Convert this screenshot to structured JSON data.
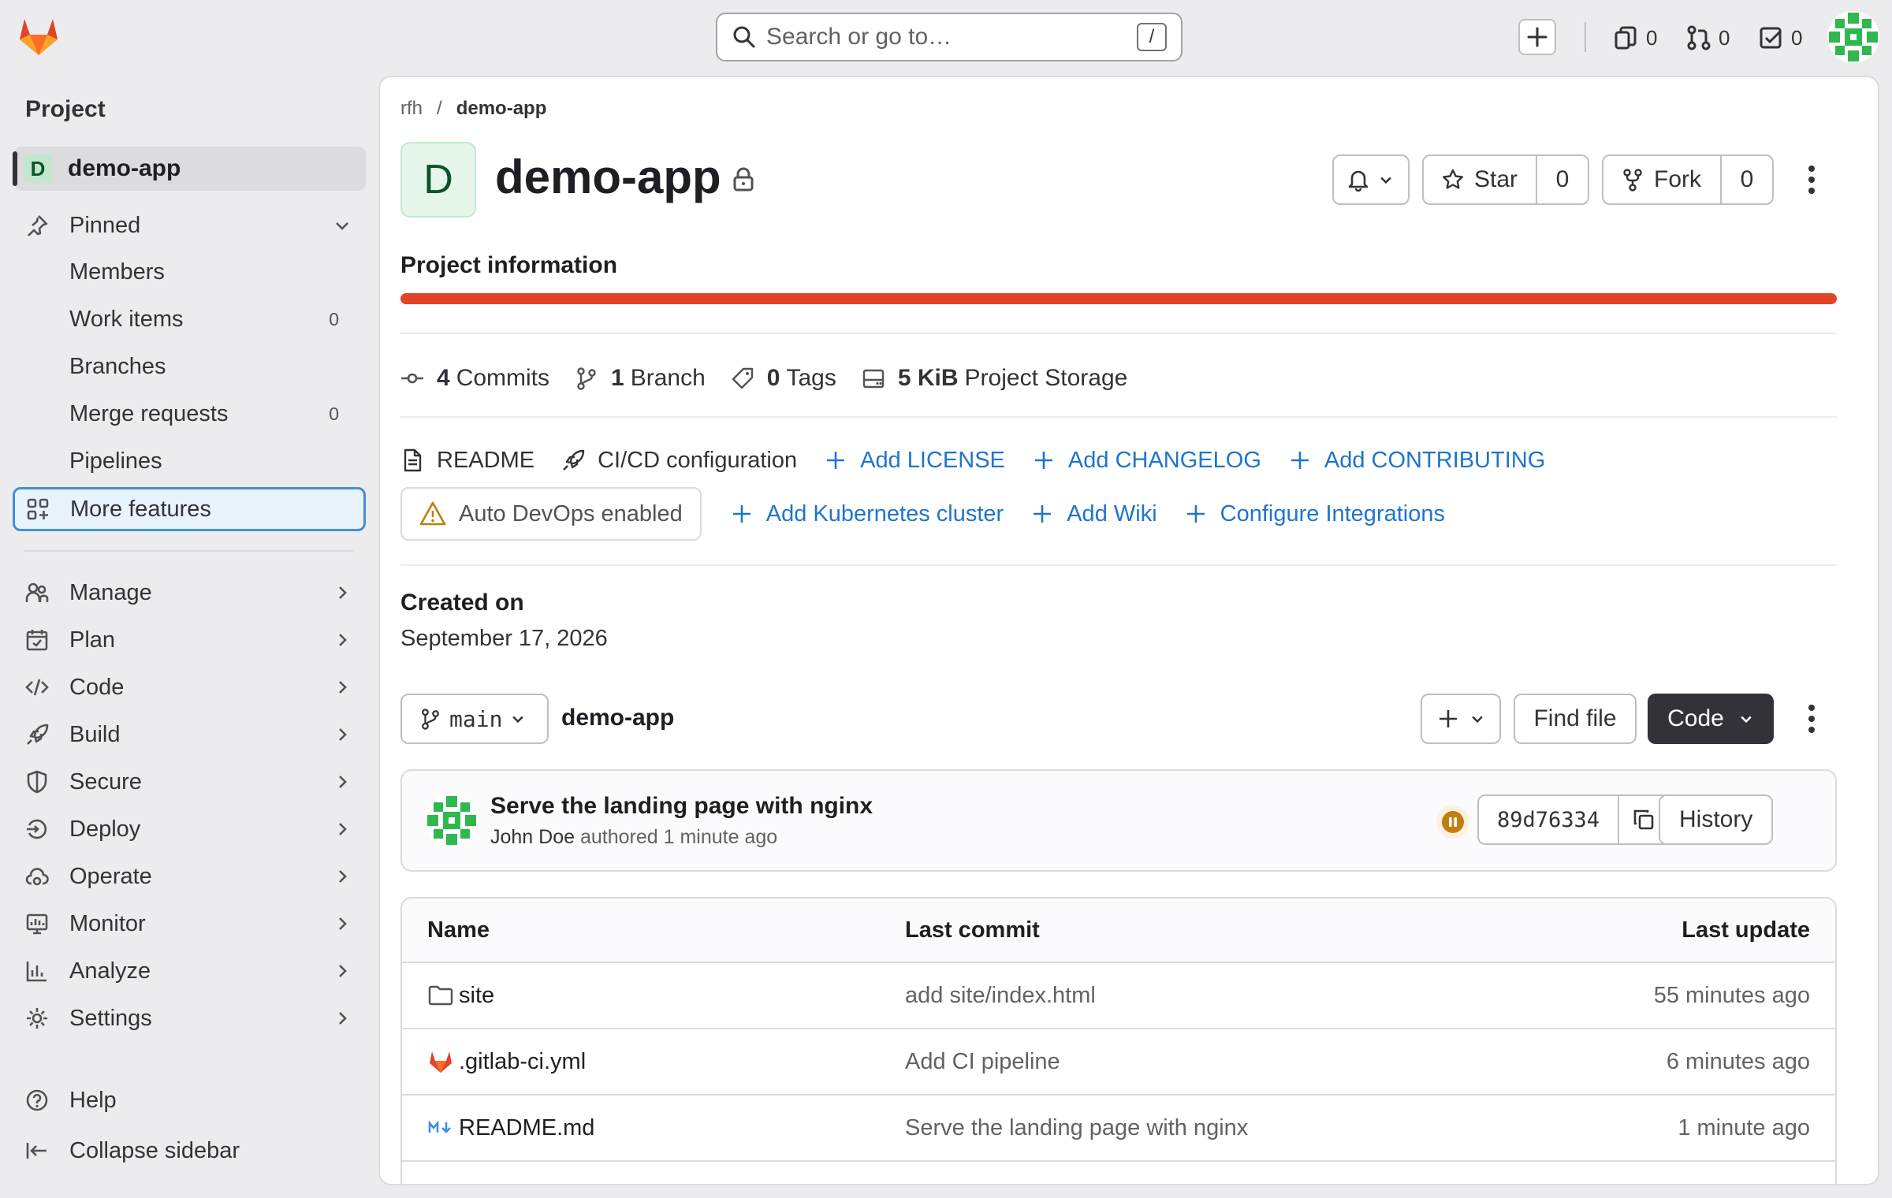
{
  "topbar": {
    "search_placeholder": "Search or go to…",
    "search_shortcut": "/",
    "issues_count": "0",
    "merge_requests_count": "0",
    "todos_count": "0"
  },
  "sidebar": {
    "heading": "Project",
    "project": {
      "initial": "D",
      "name": "demo-app"
    },
    "pinned_label": "Pinned",
    "pinned_items": [
      {
        "label": "Members",
        "count": ""
      },
      {
        "label": "Work items",
        "count": "0"
      },
      {
        "label": "Branches",
        "count": ""
      },
      {
        "label": "Merge requests",
        "count": "0"
      },
      {
        "label": "Pipelines",
        "count": ""
      }
    ],
    "more_features": "More features",
    "sections": [
      "Manage",
      "Plan",
      "Code",
      "Build",
      "Secure",
      "Deploy",
      "Operate",
      "Monitor",
      "Analyze",
      "Settings"
    ],
    "help": "Help",
    "collapse": "Collapse sidebar"
  },
  "breadcrumb": {
    "group": "rfh",
    "separator": "/",
    "project": "demo-app"
  },
  "project": {
    "initial": "D",
    "title": "demo-app",
    "star_label": "Star",
    "star_count": "0",
    "fork_label": "Fork",
    "fork_count": "0"
  },
  "info": {
    "title": "Project information",
    "stats": {
      "commits_num": "4",
      "commits_label": "Commits",
      "branch_num": "1",
      "branch_label": "Branch",
      "tags_num": "0",
      "tags_label": "Tags",
      "storage_num": "5 KiB",
      "storage_label": "Project Storage"
    },
    "links_row1": {
      "readme": "README",
      "cicd": "CI/CD configuration",
      "add_license": "Add LICENSE",
      "add_changelog": "Add CHANGELOG",
      "add_contributing": "Add CONTRIBUTING"
    },
    "links_row2": {
      "autodevops": "Auto DevOps enabled",
      "add_k8s": "Add Kubernetes cluster",
      "add_wiki": "Add Wiki",
      "configure_integrations": "Configure Integrations"
    },
    "created_label": "Created on",
    "created_value": "September 17, 2026"
  },
  "repo": {
    "branch": "main",
    "name": "demo-app",
    "find_file": "Find file",
    "code_label": "Code"
  },
  "last_commit": {
    "title": "Serve the landing page with nginx",
    "author": "John Doe",
    "meta": "authored 1 minute ago",
    "sha": "89d76334",
    "history": "History"
  },
  "files": {
    "headers": {
      "name": "Name",
      "last_commit": "Last commit",
      "last_update": "Last update"
    },
    "rows": [
      {
        "name": "site",
        "commit": "add site/index.html",
        "updated": "55 minutes ago"
      },
      {
        "name": ".gitlab-ci.yml",
        "commit": "Add CI pipeline",
        "updated": "6 minutes ago"
      },
      {
        "name": "README.md",
        "commit": "Serve the landing page with nginx",
        "updated": "1 minute ago"
      }
    ]
  },
  "colors": {
    "brand": "#e24329",
    "link": "#1f75cb",
    "code_button": "#333238",
    "status_running": "#c17d10"
  }
}
